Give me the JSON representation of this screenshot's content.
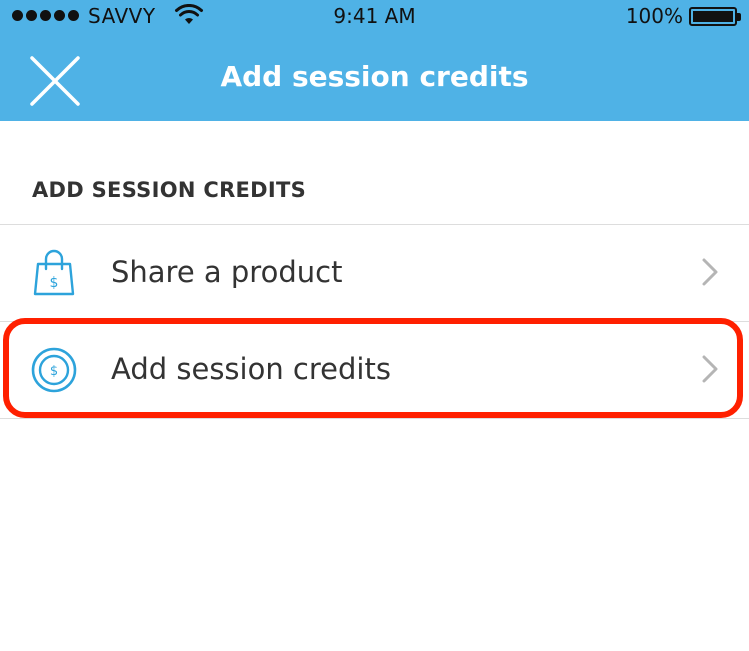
{
  "status_bar": {
    "carrier": "SAVVY",
    "time": "9:41 AM",
    "battery": "100%"
  },
  "nav": {
    "title": "Add session credits",
    "close_icon": "close-icon"
  },
  "section": {
    "header": "ADD SESSION CREDITS"
  },
  "items": [
    {
      "label": "Share a product",
      "icon": "shopping-bag-dollar-icon"
    },
    {
      "label": "Add session credits",
      "icon": "coin-dollar-icon"
    }
  ],
  "colors": {
    "header_bg": "#4fb2e6",
    "accent": "#2da3db",
    "highlight": "#ff2000"
  }
}
